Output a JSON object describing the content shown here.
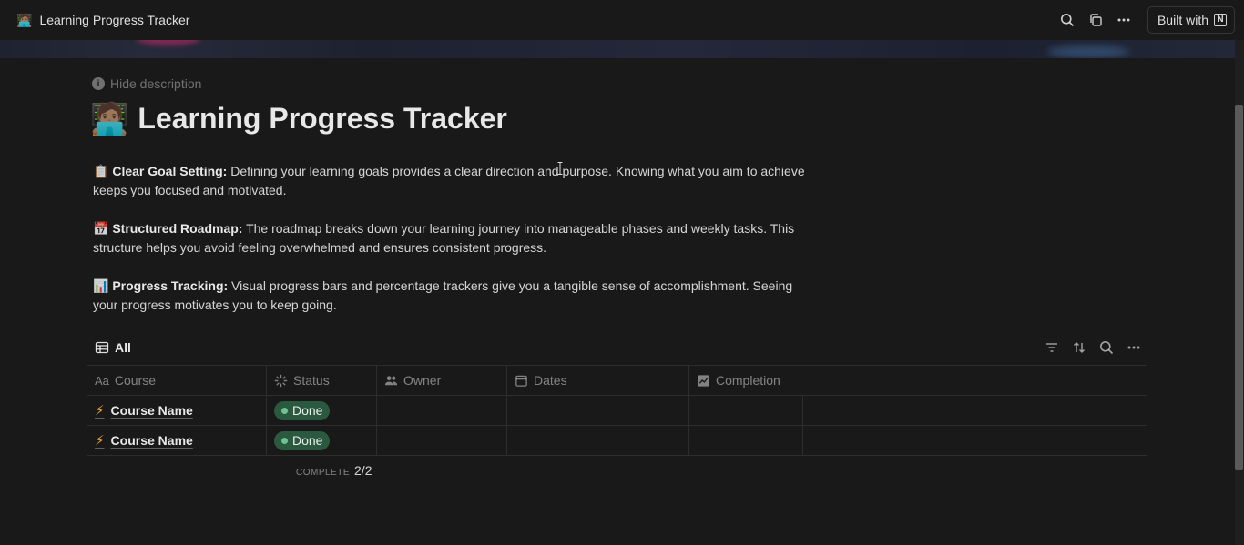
{
  "topbar": {
    "page_emoji": "🧑🏽‍💻",
    "page_title": "Learning Progress Tracker",
    "built_with_label": "Built with",
    "icons": [
      "search-icon",
      "duplicate-icon",
      "more-icon",
      "notion-logo-icon"
    ]
  },
  "page": {
    "hide_description_label": "Hide description",
    "title_emoji": "🧑🏽‍💻",
    "title": "Learning Progress Tracker",
    "description": [
      {
        "emoji": "📋",
        "heading": "Clear Goal Setting:",
        "text": " Defining your learning goals provides a clear direction and purpose. Knowing what you aim to achieve keeps you focused and motivated."
      },
      {
        "emoji": "📅",
        "heading": "Structured Roadmap:",
        "text": " The roadmap breaks down your learning journey into manageable phases and weekly tasks. This structure helps you avoid feeling overwhelmed and ensures consistent progress."
      },
      {
        "emoji": "📊",
        "heading": "Progress Tracking:",
        "text": " Visual progress bars and percentage trackers give you a tangible sense of accomplishment. Seeing your progress motivates you to keep going."
      }
    ]
  },
  "view": {
    "tab_label": "All",
    "tools": [
      "filter-icon",
      "sort-icon",
      "search-icon",
      "more-icon"
    ]
  },
  "table": {
    "columns": [
      {
        "icon": "Aa",
        "label": "Course"
      },
      {
        "icon": "status-icon",
        "label": "Status"
      },
      {
        "icon": "people-icon",
        "label": "Owner"
      },
      {
        "icon": "calendar-icon",
        "label": "Dates"
      },
      {
        "icon": "chart-icon",
        "label": "Completion"
      }
    ],
    "rows": [
      {
        "course": "Course Name",
        "status": "Done",
        "owner": "",
        "dates": "",
        "completion": ""
      },
      {
        "course": "Course Name",
        "status": "Done",
        "owner": "",
        "dates": "",
        "completion": ""
      }
    ],
    "footer": {
      "label": "COMPLETE",
      "value": "2/2"
    }
  },
  "colors": {
    "background": "#191919",
    "status_done_bg": "#2b593f",
    "status_done_dot": "#6cc48f",
    "bolt": "#e8a33a"
  }
}
